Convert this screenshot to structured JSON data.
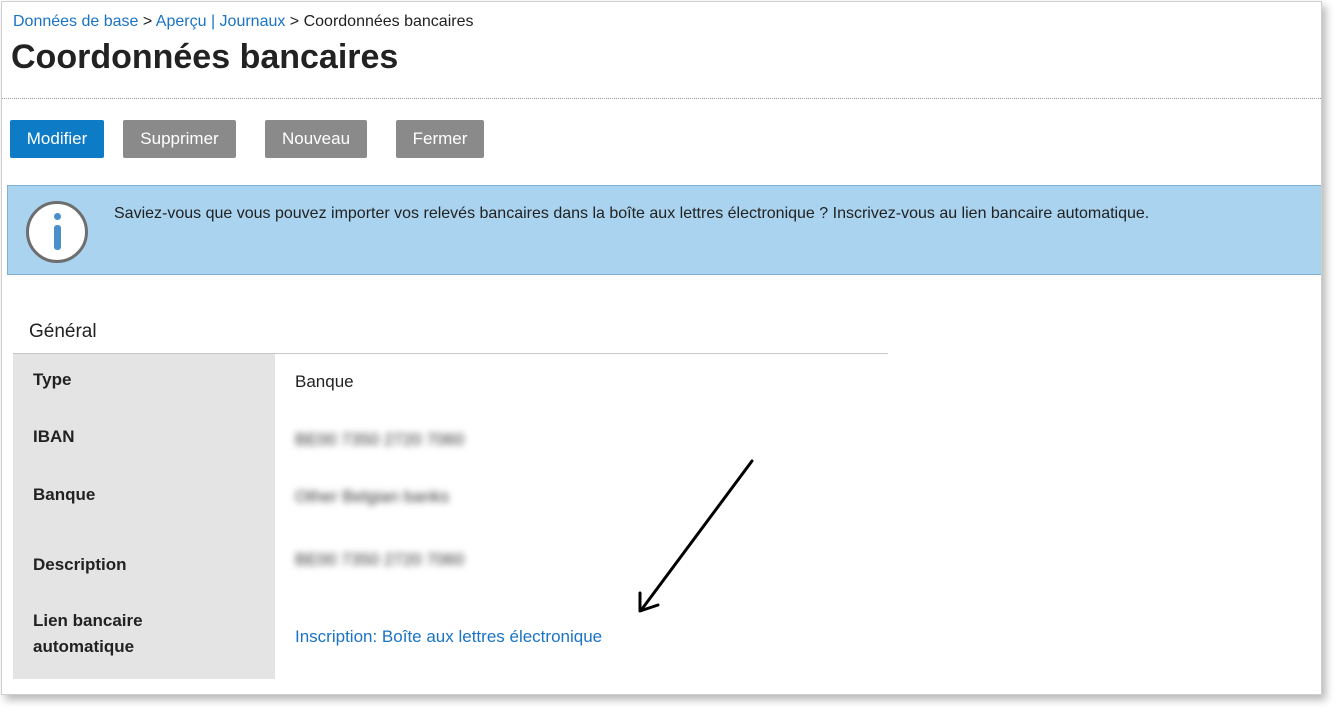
{
  "breadcrumb": {
    "item1": "Données de base",
    "sep1": " > ",
    "item2": "Aperçu | Journaux",
    "sep2": " > ",
    "current": "Coordonnées bancaires"
  },
  "page": {
    "title": "Coordonnées bancaires"
  },
  "toolbar": {
    "edit_label": "Modifier",
    "delete_label": "Supprimer",
    "new_label": "Nouveau",
    "close_label": "Fermer"
  },
  "info": {
    "message": "Saviez-vous que vous pouvez importer vos relevés bancaires dans la boîte aux lettres électronique ? Inscrivez-vous au lien bancaire automatique.",
    "icon": "info-icon"
  },
  "general": {
    "title": "Général",
    "fields": [
      {
        "label": "Type",
        "value": "Banque"
      },
      {
        "label": "IBAN",
        "value": "BE00 7350 2720 7060"
      },
      {
        "label": "Banque",
        "value": "Other Belgian banks"
      },
      {
        "label": "Description",
        "value": "BE00 7350 2720 7060"
      },
      {
        "label": "Lien bancaire automatique",
        "value": "Inscription: Boîte aux lettres électronique"
      }
    ]
  },
  "colors": {
    "primary": "#0e7bc6",
    "secondary_button": "#8a8a8a",
    "info_background": "#a9d3ee",
    "link": "#1a73c4",
    "label_column": "#e4e4e4"
  }
}
